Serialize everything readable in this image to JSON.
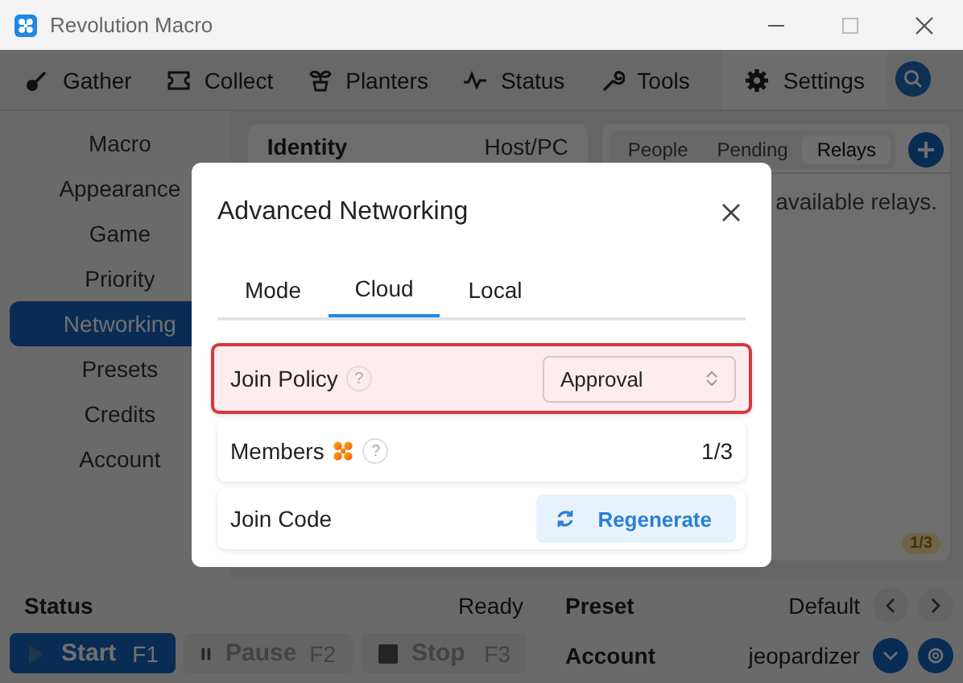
{
  "window": {
    "title": "Revolution Macro"
  },
  "nav_tabs": [
    {
      "label": "Gather",
      "selected": false
    },
    {
      "label": "Collect",
      "selected": false
    },
    {
      "label": "Planters",
      "selected": false
    },
    {
      "label": "Status",
      "selected": false
    },
    {
      "label": "Tools",
      "selected": false
    },
    {
      "label": "Settings",
      "selected": true
    }
  ],
  "sidebar": {
    "items": [
      {
        "label": "Macro",
        "selected": false
      },
      {
        "label": "Appearance",
        "selected": false
      },
      {
        "label": "Game",
        "selected": false
      },
      {
        "label": "Priority",
        "selected": false
      },
      {
        "label": "Networking",
        "selected": true
      },
      {
        "label": "Presets",
        "selected": false
      },
      {
        "label": "Credits",
        "selected": false
      },
      {
        "label": "Account",
        "selected": false
      }
    ]
  },
  "identity_card": {
    "label": "Identity",
    "value": "Host/PC"
  },
  "relays_panel": {
    "segments": [
      {
        "label": "People",
        "selected": false
      },
      {
        "label": "Pending",
        "selected": false
      },
      {
        "label": "Relays",
        "selected": true
      }
    ],
    "message": "available relays.",
    "badge": "1/3"
  },
  "status_panel": {
    "label": "Status",
    "value": "Ready",
    "buttons": [
      {
        "label": "Start",
        "key": "F1",
        "disabled": false
      },
      {
        "label": "Pause",
        "key": "F2",
        "disabled": true
      },
      {
        "label": "Stop",
        "key": "F3",
        "disabled": true
      }
    ]
  },
  "preset": {
    "label": "Preset",
    "value": "Default"
  },
  "account": {
    "label": "Account",
    "value": "jeopardizer"
  },
  "dialog": {
    "title": "Advanced Networking",
    "tabs": [
      {
        "label": "Mode",
        "selected": false
      },
      {
        "label": "Cloud",
        "selected": true
      },
      {
        "label": "Local",
        "selected": false
      }
    ],
    "rows": [
      {
        "kind": "select",
        "label": "Join Policy",
        "help": "?",
        "logo": false,
        "highlighted": true,
        "value": "Approval"
      },
      {
        "kind": "count",
        "label": "Members",
        "help": "?",
        "logo": true,
        "highlighted": false,
        "value": "1/3"
      },
      {
        "kind": "action",
        "label": "Join Code",
        "logo": false,
        "highlighted": false,
        "value": "Regenerate"
      }
    ]
  }
}
